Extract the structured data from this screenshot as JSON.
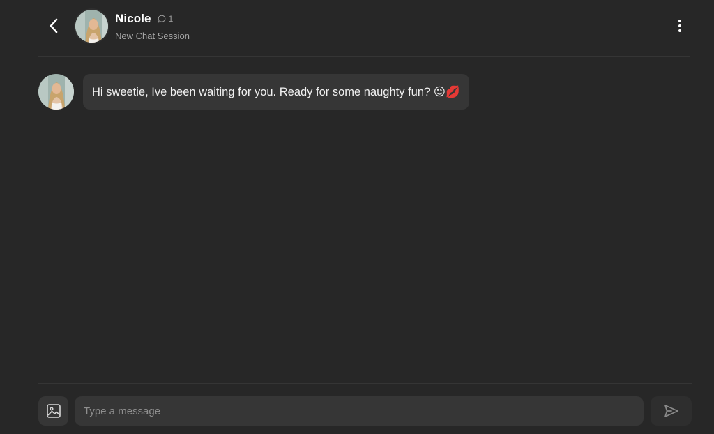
{
  "header": {
    "name": "Nicole",
    "chat_count": "1",
    "subtitle": "New Chat Session",
    "icons": {
      "back": "chevron-left-icon",
      "count": "chat-bubble-icon",
      "menu": "more-vertical-icon"
    }
  },
  "messages": [
    {
      "sender": "Nicole",
      "text": "Hi sweetie, Ive been waiting for you. Ready for some naughty fun? 😉💋"
    }
  ],
  "composer": {
    "placeholder": "Type a message",
    "value": "",
    "icons": {
      "attach": "image-icon",
      "send": "send-icon"
    }
  },
  "colors": {
    "background": "#272727",
    "surface": "#363636",
    "divider": "#353535",
    "text": "#ffffff",
    "muted": "#a6a6a6"
  }
}
